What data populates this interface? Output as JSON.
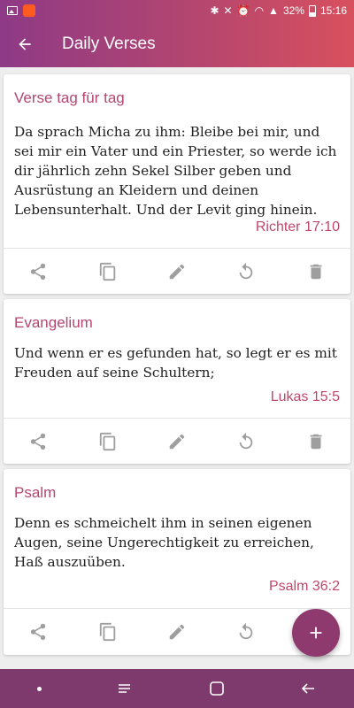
{
  "status_bar": {
    "battery": "32%",
    "time": "15:16"
  },
  "app_bar": {
    "title": "Daily Verses",
    "back_icon": "arrow-back-icon"
  },
  "cards": [
    {
      "title": "Verse tag für tag",
      "text": "Da sprach Micha zu ihm: Bleibe bei mir, und sei mir ein Vater und ein Priester, so werde ich dir jährlich zehn Sekel Silber geben und Ausrüstung an Kleidern und deinen Lebensunterhalt. Und der Levit ging hinein.",
      "reference": "Richter 17:10"
    },
    {
      "title": "Evangelium",
      "text": "Und wenn er es gefunden hat, so legt er es mit Freuden auf seine Schultern;",
      "reference": "Lukas 15:5"
    },
    {
      "title": "Psalm",
      "text": "Denn es schmeichelt ihm in seinen eigenen Augen, seine Ungerechtigkeit zu erreichen, Haß auszuüben.",
      "reference": "Psalm 36:2"
    }
  ],
  "card_actions": [
    "share-icon",
    "copy-icon",
    "edit-icon",
    "refresh-icon",
    "delete-icon"
  ],
  "fab": {
    "icon": "add-icon"
  },
  "colors": {
    "accent": "#b4466f",
    "gradient_start": "#8e3a86",
    "gradient_end": "#d8505e",
    "icon_gray": "#9e9e9e"
  }
}
